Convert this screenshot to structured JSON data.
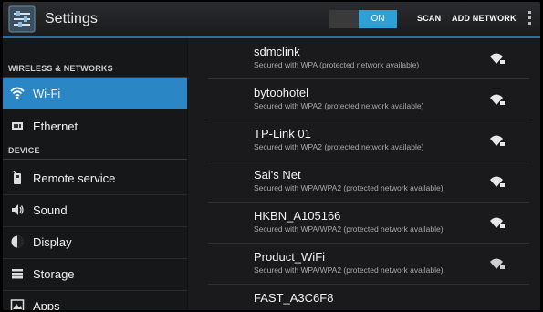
{
  "header": {
    "title": "Settings",
    "toggle_label": "ON",
    "scan_label": "SCAN",
    "add_network_label": "ADD NETWORK",
    "accent_color": "#2f9fd8"
  },
  "sidebar": {
    "section_wireless": "WIRELESS & NETWORKS",
    "section_device": "DEVICE",
    "items": [
      {
        "label": "Wi-Fi",
        "icon": "wifi-icon",
        "selected": true
      },
      {
        "label": "Ethernet",
        "icon": "ethernet-icon",
        "selected": false
      },
      {
        "label": "Remote service",
        "icon": "remote-service-icon",
        "selected": false
      },
      {
        "label": "Sound",
        "icon": "speaker-icon",
        "selected": false
      },
      {
        "label": "Display",
        "icon": "display-icon",
        "selected": false
      },
      {
        "label": "Storage",
        "icon": "storage-icon",
        "selected": false
      },
      {
        "label": "Apps",
        "icon": "apps-icon",
        "selected": false
      }
    ],
    "selected_color": "#2a86c5"
  },
  "networks": [
    {
      "name": "sdmclink",
      "security": "Secured with WPA (protected network available)",
      "icon": "wifi-signal-locked-icon"
    },
    {
      "name": "bytoohotel",
      "security": "Secured with WPA2 (protected network available)",
      "icon": "wifi-signal-locked-icon"
    },
    {
      "name": "TP-Link 01",
      "security": "Secured with WPA2 (protected network available)",
      "icon": "wifi-signal-locked-icon"
    },
    {
      "name": "Sai's Net",
      "security": "Secured with WPA/WPA2 (protected network available)",
      "icon": "wifi-signal-locked-icon"
    },
    {
      "name": "HKBN_A105166",
      "security": "Secured with WPA/WPA2 (protected network available)",
      "icon": "wifi-signal-locked-icon"
    },
    {
      "name": "Product_WiFi",
      "security": "Secured with WPA/WPA2 (protected network available)",
      "icon": "wifi-signal-locked-icon"
    },
    {
      "name": "FAST_A3C6F8",
      "security": "",
      "icon": "wifi-signal-locked-icon"
    }
  ]
}
